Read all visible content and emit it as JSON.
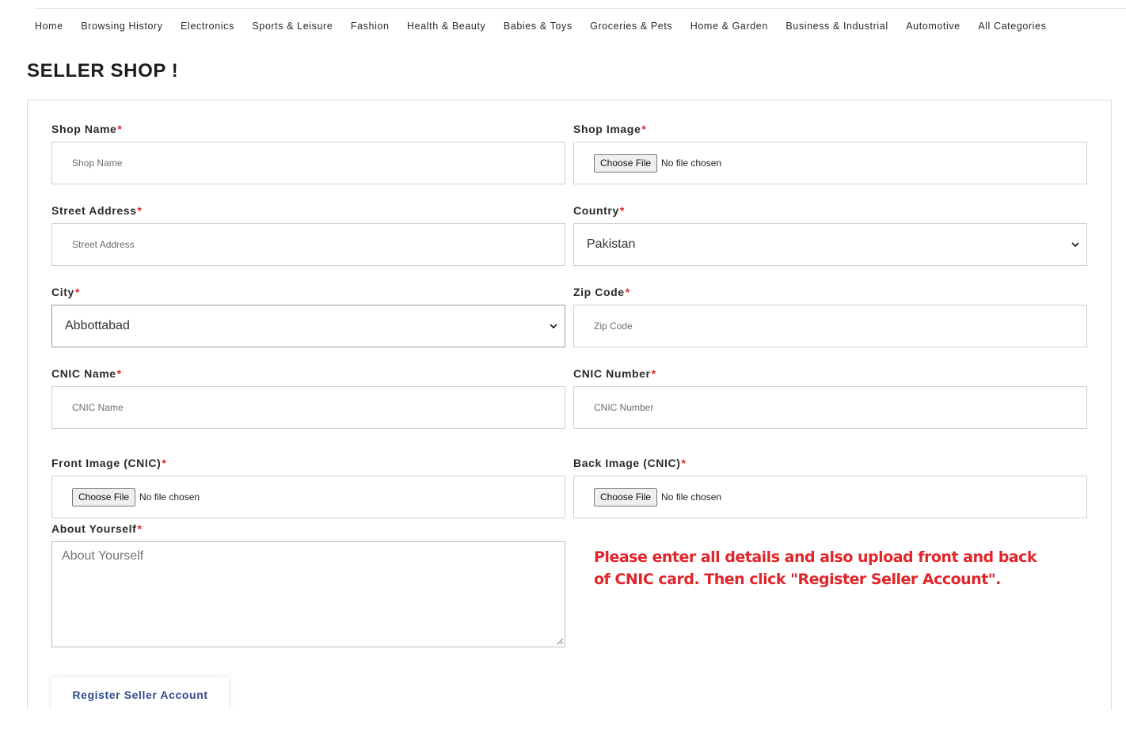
{
  "nav": {
    "items": [
      {
        "label": "Home"
      },
      {
        "label": "Browsing History"
      },
      {
        "label": "Electronics"
      },
      {
        "label": "Sports & Leisure"
      },
      {
        "label": "Fashion"
      },
      {
        "label": "Health & Beauty"
      },
      {
        "label": "Babies & Toys"
      },
      {
        "label": "Groceries & Pets"
      },
      {
        "label": "Home & Garden"
      },
      {
        "label": "Business & Industrial"
      },
      {
        "label": "Automotive"
      },
      {
        "label": "All Categories"
      }
    ]
  },
  "page": {
    "title": "SELLER SHOP !"
  },
  "form": {
    "required_mark": "*",
    "shop_name": {
      "label": "Shop Name",
      "placeholder": "Shop Name"
    },
    "shop_image": {
      "label": "Shop Image",
      "button": "Choose File",
      "status": "No file chosen"
    },
    "street_address": {
      "label": "Street Address",
      "placeholder": "Street Address"
    },
    "country": {
      "label": "Country",
      "value": "Pakistan"
    },
    "city": {
      "label": "City",
      "value": "Abbottabad"
    },
    "zip_code": {
      "label": "Zip Code",
      "placeholder": "Zip Code"
    },
    "cnic_name": {
      "label": "CNIC Name",
      "placeholder": "CNIC Name"
    },
    "cnic_number": {
      "label": "CNIC Number",
      "placeholder": "CNIC Number"
    },
    "front_image": {
      "label": "Front Image (CNIC)",
      "button": "Choose File",
      "status": "No file chosen"
    },
    "back_image": {
      "label": "Back Image (CNIC)",
      "button": "Choose File",
      "status": "No file chosen"
    },
    "about": {
      "label": "About Yourself",
      "placeholder": "About Yourself"
    },
    "submit_label": "Register Seller Account"
  },
  "notice": {
    "text": "Please enter all details and also upload front and back of CNIC card. Then click \"Register Seller Account\"."
  },
  "colors": {
    "required": "#e0262b",
    "notice": "#e0262b",
    "submit_text": "#2f4b8c"
  },
  "icons": {
    "select_arrow": "chevron-down-icon",
    "textarea_resize": "resize-grip-icon"
  }
}
